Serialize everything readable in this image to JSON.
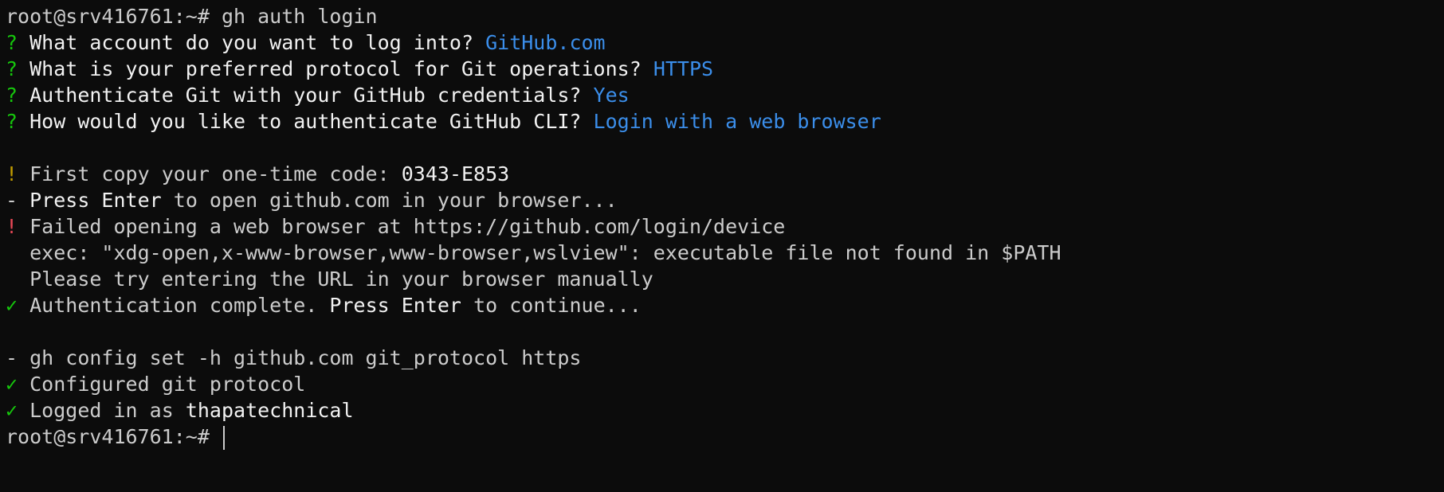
{
  "terminal": {
    "prompt": "root@srv416761:~#",
    "command": "gh auth login",
    "questions": [
      {
        "marker": "?",
        "text": "What account do you want to log into?",
        "answer": "GitHub.com"
      },
      {
        "marker": "?",
        "text": "What is your preferred protocol for Git operations?",
        "answer": "HTTPS"
      },
      {
        "marker": "?",
        "text": "Authenticate Git with your GitHub credentials?",
        "answer": "Yes"
      },
      {
        "marker": "?",
        "text": "How would you like to authenticate GitHub CLI?",
        "answer": "Login with a web browser"
      }
    ],
    "code_line": {
      "marker": "!",
      "text": "First copy your one-time code:",
      "code": "0343-E853"
    },
    "press_line": {
      "marker": "-",
      "emph": "Press Enter",
      "rest": "to open github.com in your browser..."
    },
    "error_line": {
      "marker": "!",
      "text": "Failed opening a web browser at https://github.com/login/device"
    },
    "exec_line": "exec: \"xdg-open,x-www-browser,www-browser,wslview\": executable file not found in $PATH",
    "manual_line": "Please try entering the URL in your browser manually",
    "auth_line": {
      "marker": "✓",
      "text": "Authentication complete.",
      "emph": "Press Enter",
      "rest": "to continue..."
    },
    "config_line": {
      "marker": "-",
      "text": "gh config set -h github.com git_protocol https"
    },
    "configured_line": {
      "marker": "✓",
      "text": "Configured git protocol"
    },
    "logged_line": {
      "marker": "✓",
      "text": "Logged in as",
      "user": "thapatechnical"
    },
    "final_prompt": "root@srv416761:~#"
  }
}
